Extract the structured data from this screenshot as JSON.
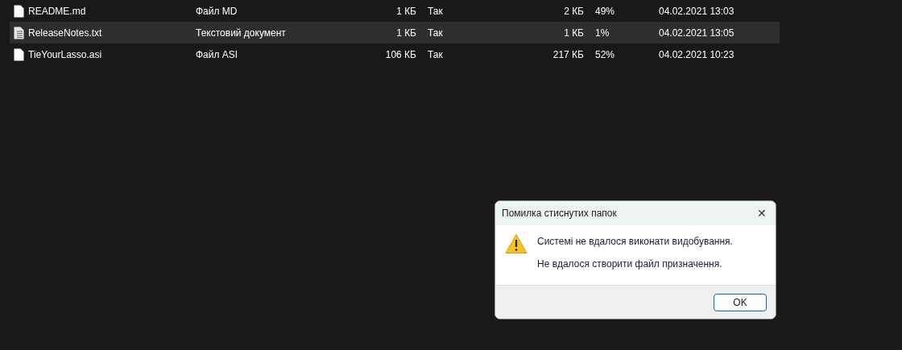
{
  "files": [
    {
      "name": "README.md",
      "kind": "plain",
      "type": "Файл MD",
      "size": "1 КБ",
      "protected": "Так",
      "packed_size": "2 КБ",
      "ratio": "49%",
      "modified": "04.02.2021 13:03",
      "selected": false
    },
    {
      "name": "ReleaseNotes.txt",
      "kind": "text",
      "type": "Текстовий документ",
      "size": "1 КБ",
      "protected": "Так",
      "packed_size": "1 КБ",
      "ratio": "1%",
      "modified": "04.02.2021 13:05",
      "selected": true
    },
    {
      "name": "TieYourLasso.asi",
      "kind": "plain",
      "type": "Файл ASI",
      "size": "106 КБ",
      "protected": "Так",
      "packed_size": "217 КБ",
      "ratio": "52%",
      "modified": "04.02.2021 10:23",
      "selected": false
    }
  ],
  "dialog": {
    "title": "Помилка стиснутих папок",
    "close": "✕",
    "messages": [
      "Системі не вдалося виконати видобування.",
      "Не вдалося створити файл призначення."
    ],
    "button": "OK"
  }
}
